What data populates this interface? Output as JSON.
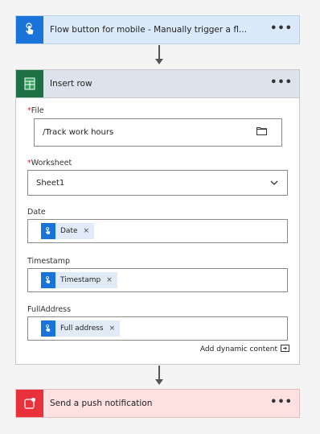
{
  "trigger": {
    "title": "Flow button for mobile - Manually trigger a fl...",
    "more": "•••",
    "color": "#1a73d9"
  },
  "insert": {
    "title": "Insert row",
    "more": "•••",
    "file": {
      "label": "File",
      "value": "/Track work hours"
    },
    "worksheet": {
      "label": "Worksheet",
      "value": "Sheet1"
    },
    "date": {
      "label": "Date",
      "token": "Date",
      "remove": "×"
    },
    "timestamp": {
      "label": "Timestamp",
      "token": "Timestamp",
      "remove": "×"
    },
    "fulladdress": {
      "label": "FullAddress",
      "token": "Full address",
      "remove": "×"
    },
    "dynamic_link": "Add dynamic content"
  },
  "push": {
    "title": "Send a push notification",
    "more": "•••",
    "color": "#e8313b"
  },
  "required_mark": "*"
}
